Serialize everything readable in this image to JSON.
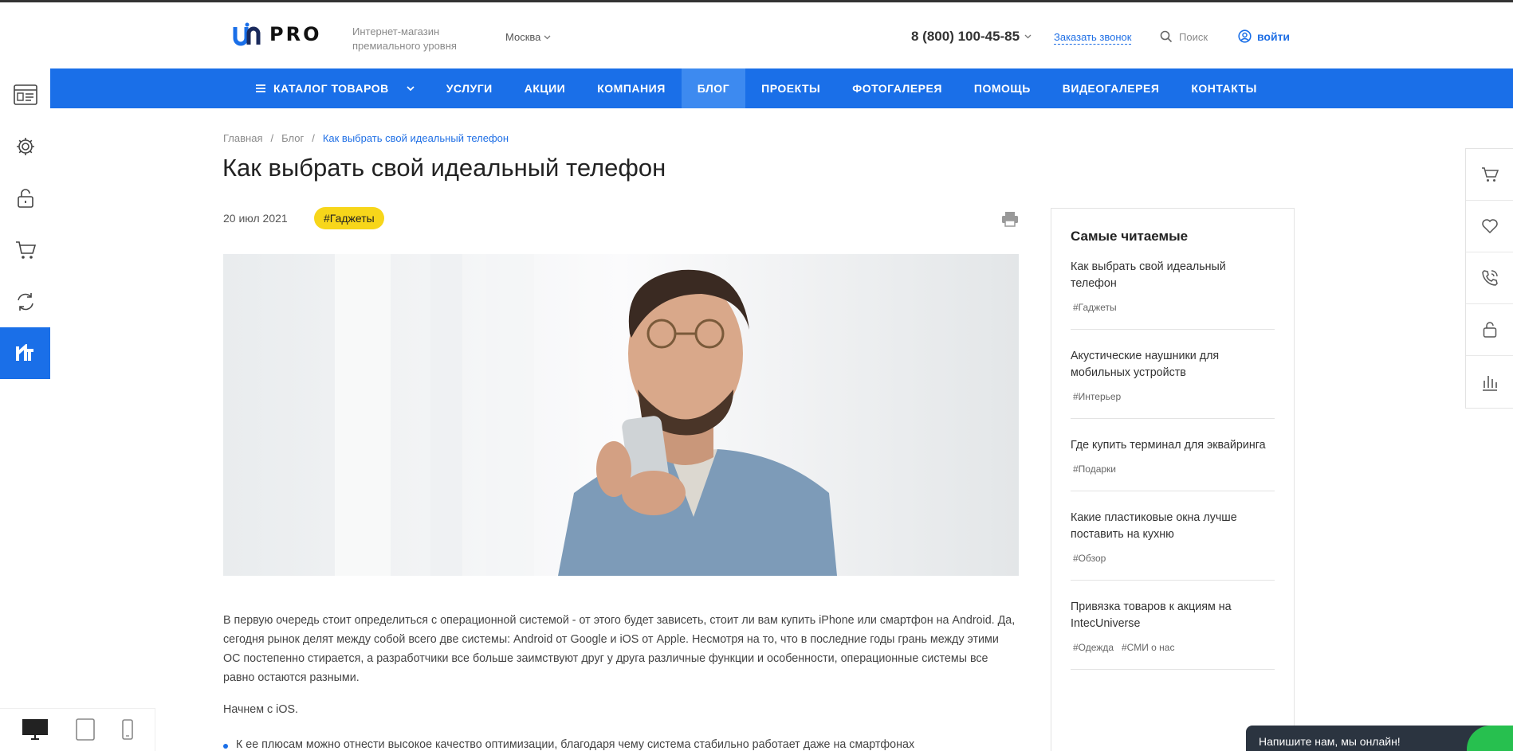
{
  "header": {
    "logo_text": "PRO",
    "tagline": "Интернет-магазин премиального уровня",
    "city": "Москва",
    "phone": "8 (800) 100-45-85",
    "callback": "Заказать звонок",
    "search": "Поиск",
    "login": "войти"
  },
  "nav": {
    "items": [
      "КАТАЛОГ ТОВАРОВ",
      "УСЛУГИ",
      "АКЦИИ",
      "КОМПАНИЯ",
      "БЛОГ",
      "ПРОЕКТЫ",
      "ФОТОГАЛЕРЕЯ",
      "ПОМОЩЬ",
      "ВИДЕОГАЛЕРЕЯ",
      "КОНТАКТЫ"
    ],
    "active": "БЛОГ"
  },
  "breadcrumbs": [
    "Главная",
    "Блог",
    "Как выбрать свой идеальный телефон"
  ],
  "article": {
    "title": "Как выбрать свой идеальный телефон",
    "date": "20 июл 2021",
    "tag": "#Гаджеты",
    "paragraph1": "В первую очередь стоит определиться с операционной системой - от этого будет зависеть, стоит ли вам купить iPhone или смартфон на Android. Да, сегодня рынок делят между собой всего две системы: Android от Google и iOS от Apple. Несмотря на то, что в последние годы грань между этими ОС постепенно стирается, а разработчики все больше заимствуют друг у друга различные функции и особенности, операционные системы все равно остаются разными.",
    "paragraph2": "Начнем с iOS.",
    "bullet1": "К ее плюсам можно отнести высокое качество оптимизации, благодаря чему система стабильно работает даже на смартфонах"
  },
  "sidebar": {
    "title": "Самые читаемые",
    "items": [
      {
        "title": "Как выбрать свой идеальный телефон",
        "tags": [
          "#Гаджеты"
        ]
      },
      {
        "title": "Акустические наушники для мобильных устройств",
        "tags": [
          "#Интерьер"
        ]
      },
      {
        "title": "Где купить терминал для эквайринга",
        "tags": [
          "#Подарки"
        ]
      },
      {
        "title": "Какие пластиковые окна лучше поставить на кухню",
        "tags": [
          "#Обзор"
        ]
      },
      {
        "title": "Привязка товаров к акциям на IntecUniverse",
        "tags": [
          "#Одежда",
          "#СМИ о нас"
        ]
      }
    ]
  },
  "chat": {
    "label": "Напишите нам, мы онлайн!"
  },
  "colors": {
    "accent": "#1a6fe8",
    "tag": "#f7d61a",
    "chat": "#2b3440",
    "online": "#27c04f"
  }
}
